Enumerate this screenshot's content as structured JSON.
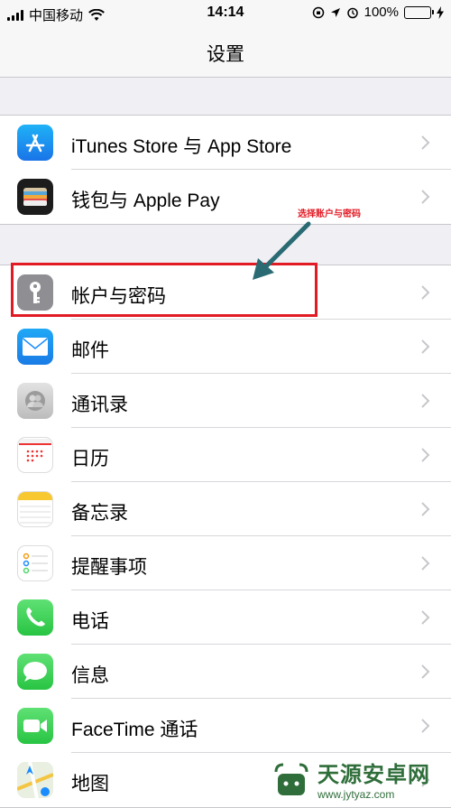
{
  "status": {
    "carrier": "中国移动",
    "time": "14:14",
    "battery": "100%"
  },
  "nav": {
    "title": "设置"
  },
  "group1": [
    {
      "label": "iTunes Store 与 App Store",
      "icon": "app-store-icon"
    },
    {
      "label": "钱包与 Apple Pay",
      "icon": "wallet-icon"
    }
  ],
  "group2": [
    {
      "label": "帐户与密码",
      "icon": "key-icon"
    },
    {
      "label": "邮件",
      "icon": "mail-icon"
    },
    {
      "label": "通讯录",
      "icon": "contacts-icon"
    },
    {
      "label": "日历",
      "icon": "calendar-icon"
    },
    {
      "label": "备忘录",
      "icon": "notes-icon"
    },
    {
      "label": "提醒事项",
      "icon": "reminders-icon"
    },
    {
      "label": "电话",
      "icon": "phone-icon"
    },
    {
      "label": "信息",
      "icon": "messages-icon"
    },
    {
      "label": "FaceTime 通话",
      "icon": "facetime-icon"
    },
    {
      "label": "地图",
      "icon": "maps-icon"
    }
  ],
  "annotation": "选择账户与密码",
  "watermark": {
    "main": "天源安卓网",
    "url": "www.jytyaz.com"
  },
  "colors": {
    "highlight": "#e21a24",
    "arrow": "#2a6b73",
    "green": "#4cd964",
    "blue": "#1a8cff"
  }
}
